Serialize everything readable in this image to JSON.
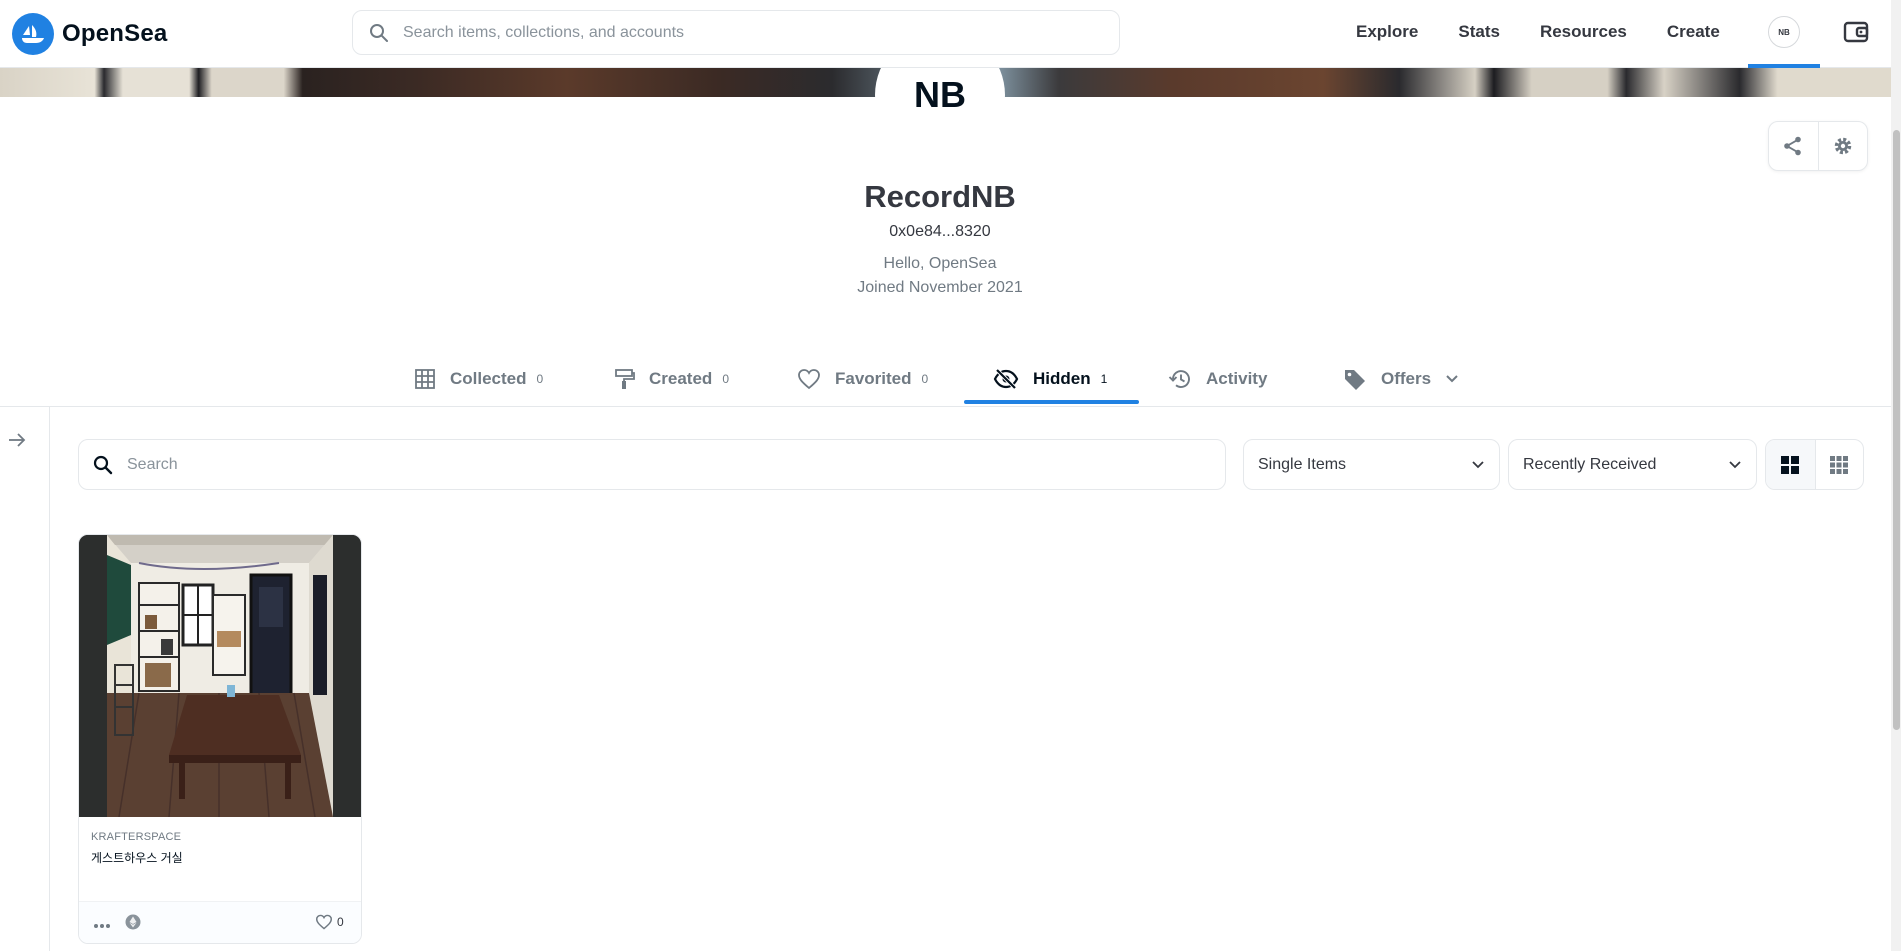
{
  "brand": {
    "name": "OpenSea"
  },
  "topnav": {
    "search_placeholder": "Search items, collections, and accounts",
    "links": [
      "Explore",
      "Stats",
      "Resources",
      "Create"
    ],
    "avatar_initials": "NB"
  },
  "profile": {
    "avatar_initials": "NB",
    "name": "RecordNB",
    "address": "0x0e84...8320",
    "bio": "Hello, OpenSea",
    "joined": "Joined November 2021"
  },
  "tabs": [
    {
      "label": "Collected",
      "count": "0",
      "icon": "grid-icon"
    },
    {
      "label": "Created",
      "count": "0",
      "icon": "paintbrush-icon"
    },
    {
      "label": "Favorited",
      "count": "0",
      "icon": "heart-icon"
    },
    {
      "label": "Hidden",
      "count": "1",
      "icon": "eye-off-icon",
      "active": true
    },
    {
      "label": "Activity",
      "count": "",
      "icon": "history-icon"
    },
    {
      "label": "Offers",
      "count": "",
      "icon": "tag-icon"
    }
  ],
  "filters": {
    "search_placeholder": "Search",
    "item_type": "Single Items",
    "sort": "Recently Received"
  },
  "items": [
    {
      "collection": "KRAFTERSPACE",
      "title": "게스트하우스 거실",
      "likes": "0"
    }
  ],
  "colors": {
    "accent": "#2081e2",
    "text_primary": "#353840",
    "text_secondary": "#707a83",
    "border": "#e5e8eb"
  }
}
